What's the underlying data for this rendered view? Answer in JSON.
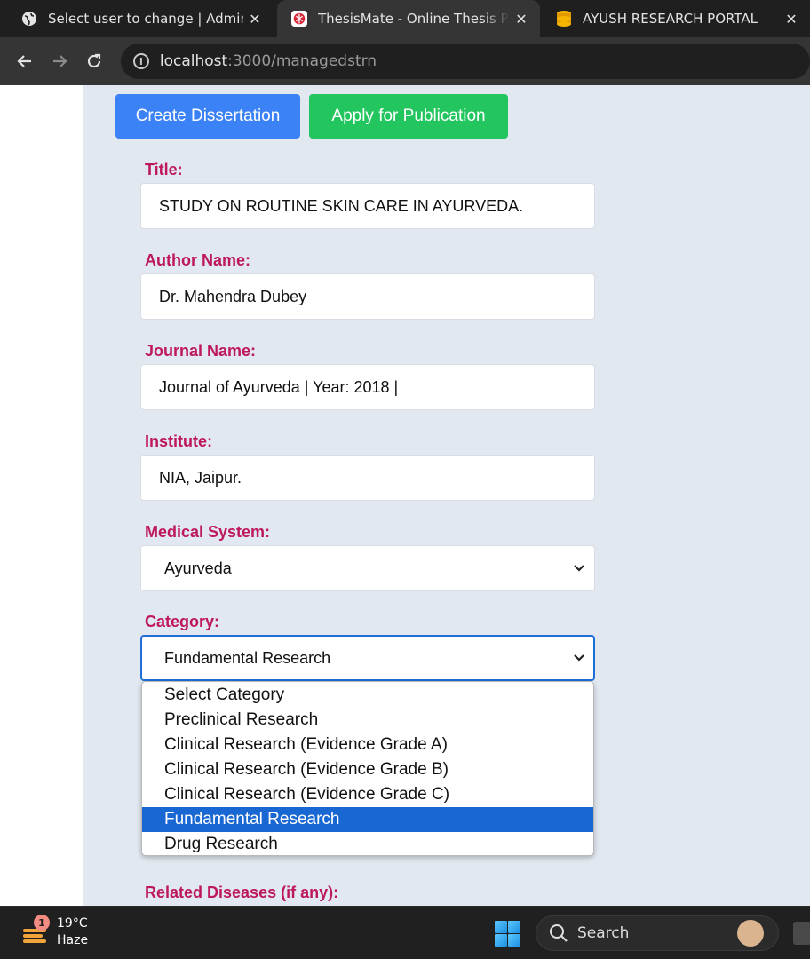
{
  "browser": {
    "tabs": [
      {
        "title": "Select user to change | Admin",
        "icon": "globe-icon",
        "close": "✕"
      },
      {
        "title": "ThesisMate - Online Thesis Portal",
        "icon": "thesismate-logo-icon",
        "close": "✕"
      },
      {
        "title": "AYUSH RESEARCH PORTAL",
        "icon": "database-coins-icon",
        "close": "✕"
      }
    ],
    "url_host": "localhost",
    "url_path": ":3000/managedstrn"
  },
  "actions": {
    "create_label": "Create Dissertation",
    "apply_label": "Apply for Publication"
  },
  "form": {
    "title_label": "Title:",
    "title_value": "STUDY ON ROUTINE SKIN CARE IN AYURVEDA.",
    "author_label": "Author Name:",
    "author_value": "Dr. Mahendra Dubey",
    "journal_label": "Journal Name:",
    "journal_value": "Journal of Ayurveda | Year: 2018 |",
    "institute_label": "Institute:",
    "institute_value": "NIA, Jaipur.",
    "medical_system_label": "Medical System:",
    "medical_system_value": "Ayurveda",
    "category_label": "Category:",
    "category_value": "Fundamental Research",
    "category_options": [
      "Select Category",
      "Preclinical Research",
      "Clinical Research (Evidence Grade A)",
      "Clinical Research (Evidence Grade B)",
      "Clinical Research (Evidence Grade C)",
      "Fundamental Research",
      "Drug Research"
    ],
    "category_selected_index": 5,
    "related_diseases_label": "Related Diseases (if any):"
  },
  "taskbar": {
    "weather_badge": "1",
    "temperature": "19°C",
    "condition": "Haze",
    "search_placeholder": "Search"
  },
  "colors": {
    "label": "#be185d",
    "create_button": "#3b82f6",
    "apply_button": "#22c55e",
    "page_background": "#e2e8f0",
    "selected_option": "#1967d2"
  }
}
